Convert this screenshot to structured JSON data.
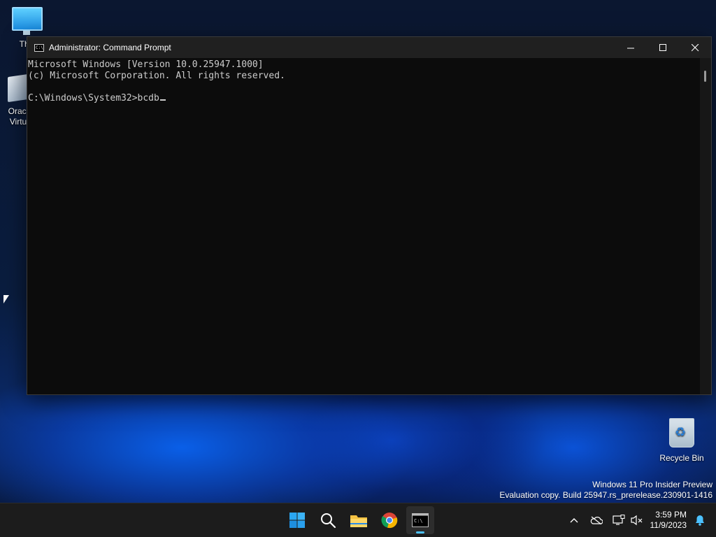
{
  "desktop": {
    "icons": [
      {
        "label": "This"
      },
      {
        "label": "Oracl\nVirtu"
      },
      {
        "label": "Recycle Bin"
      }
    ]
  },
  "window": {
    "title": "Administrator: Command Prompt",
    "console_lines": [
      "Microsoft Windows [Version 10.0.25947.1000]",
      "(c) Microsoft Corporation. All rights reserved.",
      "",
      "C:\\Windows\\System32>bcdb"
    ]
  },
  "watermark": {
    "line1": "Windows 11 Pro Insider Preview",
    "line2": "Evaluation copy. Build 25947.rs_prerelease.230901-1416"
  },
  "taskbar": {
    "apps": [
      "start-icon",
      "search-icon",
      "file-explorer-icon",
      "chrome-icon",
      "command-prompt-icon"
    ],
    "clock": {
      "time": "3:59 PM",
      "date": "11/9/2023"
    }
  }
}
